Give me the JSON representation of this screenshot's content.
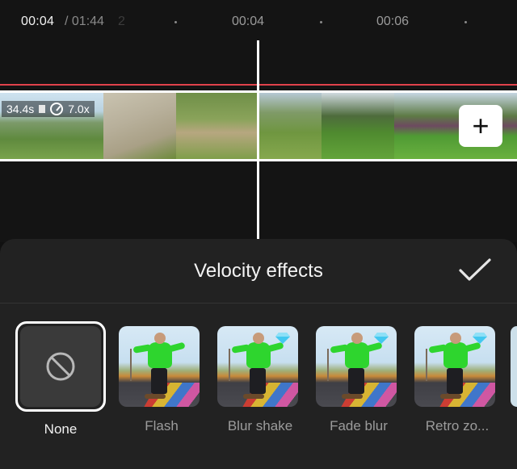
{
  "timeline": {
    "current_time": "00:04",
    "total_time": "/ 01:44",
    "ghost_digit": "2",
    "ticks": [
      "00:04",
      "00:06"
    ],
    "clip": {
      "duration": "34.4s",
      "speed": "7.0x"
    },
    "add_label": "+"
  },
  "sheet": {
    "title": "Velocity effects",
    "effects": [
      {
        "label": "None",
        "selected": true
      },
      {
        "label": "Flash",
        "selected": false,
        "premium": false
      },
      {
        "label": "Blur shake",
        "selected": false,
        "premium": true
      },
      {
        "label": "Fade blur",
        "selected": false,
        "premium": true
      },
      {
        "label": "Retro zo...",
        "selected": false,
        "premium": true
      }
    ]
  },
  "colors": {
    "accent_red": "#e0424b",
    "premium_gem": "#43c8f0",
    "background": "#141414",
    "sheet": "#222222"
  }
}
